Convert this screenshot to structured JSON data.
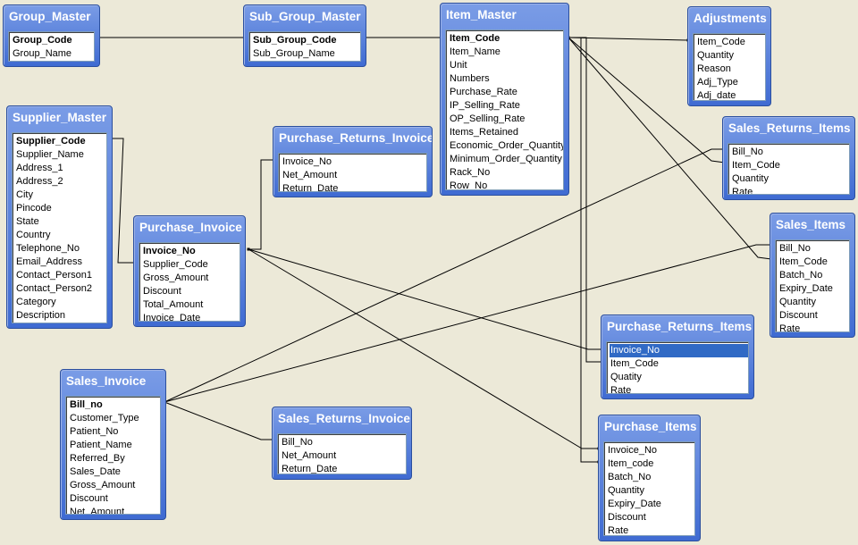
{
  "diagram": {
    "tables": [
      {
        "id": "group_master",
        "title": "Group_Master",
        "fields": [
          "Group_Code",
          "Group_Name"
        ],
        "pk": [
          0
        ]
      },
      {
        "id": "sub_group_master",
        "title": "Sub_Group_Master",
        "fields": [
          "Sub_Group_Code",
          "Sub_Group_Name"
        ],
        "pk": [
          0
        ]
      },
      {
        "id": "item_master",
        "title": "Item_Master",
        "fields": [
          "Item_Code",
          "Item_Name",
          "Unit",
          "Numbers",
          "Purchase_Rate",
          "IP_Selling_Rate",
          "OP_Selling_Rate",
          "Items_Retained",
          "Economic_Order_Quantity",
          "Minimum_Order_Quantity",
          "Rack_No",
          "Row_No"
        ],
        "pk": [
          0
        ]
      },
      {
        "id": "adjustments",
        "title": "Adjustments",
        "fields": [
          "Item_Code",
          "Quantity",
          "Reason",
          "Adj_Type",
          "Adj_date"
        ],
        "pk": []
      },
      {
        "id": "supplier_master",
        "title": "Supplier_Master",
        "fields": [
          "Supplier_Code",
          "Supplier_Name",
          "Address_1",
          "Address_2",
          "City",
          "Pincode",
          "State",
          "Country",
          "Telephone_No",
          "Email_Address",
          "Contact_Person1",
          "Contact_Person2",
          "Category",
          "Description"
        ],
        "pk": [
          0
        ]
      },
      {
        "id": "purchase_returns_invoice",
        "title": "Purchase_Returns_Invoice",
        "fields": [
          "Invoice_No",
          "Net_Amount",
          "Return_Date"
        ],
        "pk": []
      },
      {
        "id": "sales_returns_items",
        "title": "Sales_Returns_Items",
        "fields": [
          "Bill_No",
          "Item_Code",
          "Quantity",
          "Rate"
        ],
        "pk": []
      },
      {
        "id": "purchase_invoice",
        "title": "Purchase_Invoice",
        "fields": [
          "Invoice_No",
          "Supplier_Code",
          "Gross_Amount",
          "Discount",
          "Total_Amount",
          "Invoice_Date"
        ],
        "pk": [
          0
        ]
      },
      {
        "id": "sales_items",
        "title": "Sales_Items",
        "fields": [
          "Bill_No",
          "Item_Code",
          "Batch_No",
          "Expiry_Date",
          "Quantity",
          "Discount",
          "Rate"
        ],
        "pk": []
      },
      {
        "id": "purchase_returns_items",
        "title": "Purchase_Returns_Items",
        "fields": [
          "Invoice_No",
          "Item_Code",
          "Quatity",
          "Rate"
        ],
        "pk": [],
        "selected": [
          0
        ]
      },
      {
        "id": "sales_invoice",
        "title": "Sales_Invoice",
        "fields": [
          "Bill_no",
          "Customer_Type",
          "Patient_No",
          "Patient_Name",
          "Referred_By",
          "Sales_Date",
          "Gross_Amount",
          "Discount",
          "Net_Amount"
        ],
        "pk": [
          0
        ]
      },
      {
        "id": "sales_returns_invoice",
        "title": "Sales_Returns_Invoice",
        "fields": [
          "Bill_No",
          "Net_Amount",
          "Return_Date"
        ],
        "pk": []
      },
      {
        "id": "purchase_items",
        "title": "Purchase_Items",
        "fields": [
          "Invoice_No",
          "Item_code",
          "Batch_No",
          "Quantity",
          "Expiry_Date",
          "Discount",
          "Rate"
        ],
        "pk": []
      }
    ],
    "relationships": [
      {
        "from": "group_master",
        "from_field": "Group_Code",
        "to": "sub_group_master",
        "to_field": "Sub_Group_Code"
      },
      {
        "from": "sub_group_master",
        "from_field": "Sub_Group_Code",
        "to": "item_master",
        "to_field": "Item_Code"
      },
      {
        "from": "item_master",
        "from_field": "Item_Code",
        "to": "adjustments",
        "to_field": "Item_Code"
      },
      {
        "from": "item_master",
        "from_field": "Item_Code",
        "to": "sales_returns_items",
        "to_field": "Item_Code"
      },
      {
        "from": "item_master",
        "from_field": "Item_Code",
        "to": "sales_items",
        "to_field": "Item_Code"
      },
      {
        "from": "item_master",
        "from_field": "Item_Code",
        "to": "purchase_returns_items",
        "to_field": "Item_Code"
      },
      {
        "from": "item_master",
        "from_field": "Item_Code",
        "to": "purchase_items",
        "to_field": "Item_code"
      },
      {
        "from": "supplier_master",
        "from_field": "Supplier_Code",
        "to": "purchase_invoice",
        "to_field": "Supplier_Code"
      },
      {
        "from": "purchase_invoice",
        "from_field": "Invoice_No",
        "to": "purchase_returns_invoice",
        "to_field": "Invoice_No"
      },
      {
        "from": "purchase_invoice",
        "from_field": "Invoice_No",
        "to": "purchase_returns_items",
        "to_field": "Invoice_No"
      },
      {
        "from": "purchase_invoice",
        "from_field": "Invoice_No",
        "to": "purchase_items",
        "to_field": "Invoice_No"
      },
      {
        "from": "sales_invoice",
        "from_field": "Bill_no",
        "to": "sales_returns_items",
        "to_field": "Bill_No"
      },
      {
        "from": "sales_invoice",
        "from_field": "Bill_no",
        "to": "sales_items",
        "to_field": "Bill_No"
      },
      {
        "from": "sales_invoice",
        "from_field": "Bill_no",
        "to": "sales_returns_invoice",
        "to_field": "Bill_No"
      }
    ]
  }
}
